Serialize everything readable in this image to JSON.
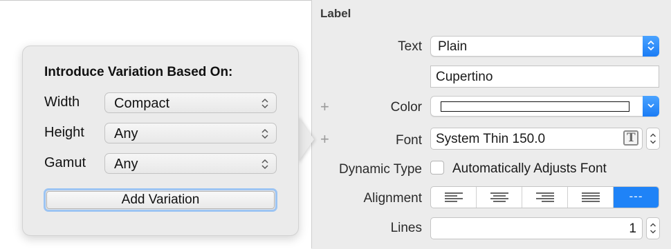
{
  "popover": {
    "title": "Introduce Variation Based On:",
    "rows": [
      {
        "label": "Width",
        "value": "Compact"
      },
      {
        "label": "Height",
        "value": "Any"
      },
      {
        "label": "Gamut",
        "value": "Any"
      }
    ],
    "add_button": "Add Variation"
  },
  "inspector": {
    "section_title": "Label",
    "text": {
      "label": "Text",
      "value": "Plain",
      "content": "Cupertino"
    },
    "color": {
      "label": "Color",
      "swatch": "#ffffff"
    },
    "font": {
      "label": "Font",
      "value": "System Thin 150.0"
    },
    "dynamic_type": {
      "label": "Dynamic Type",
      "checkbox_label": "Automatically Adjusts Font",
      "checked": false
    },
    "alignment": {
      "label": "Alignment",
      "active": "---"
    },
    "lines": {
      "label": "Lines",
      "value": "1"
    }
  }
}
